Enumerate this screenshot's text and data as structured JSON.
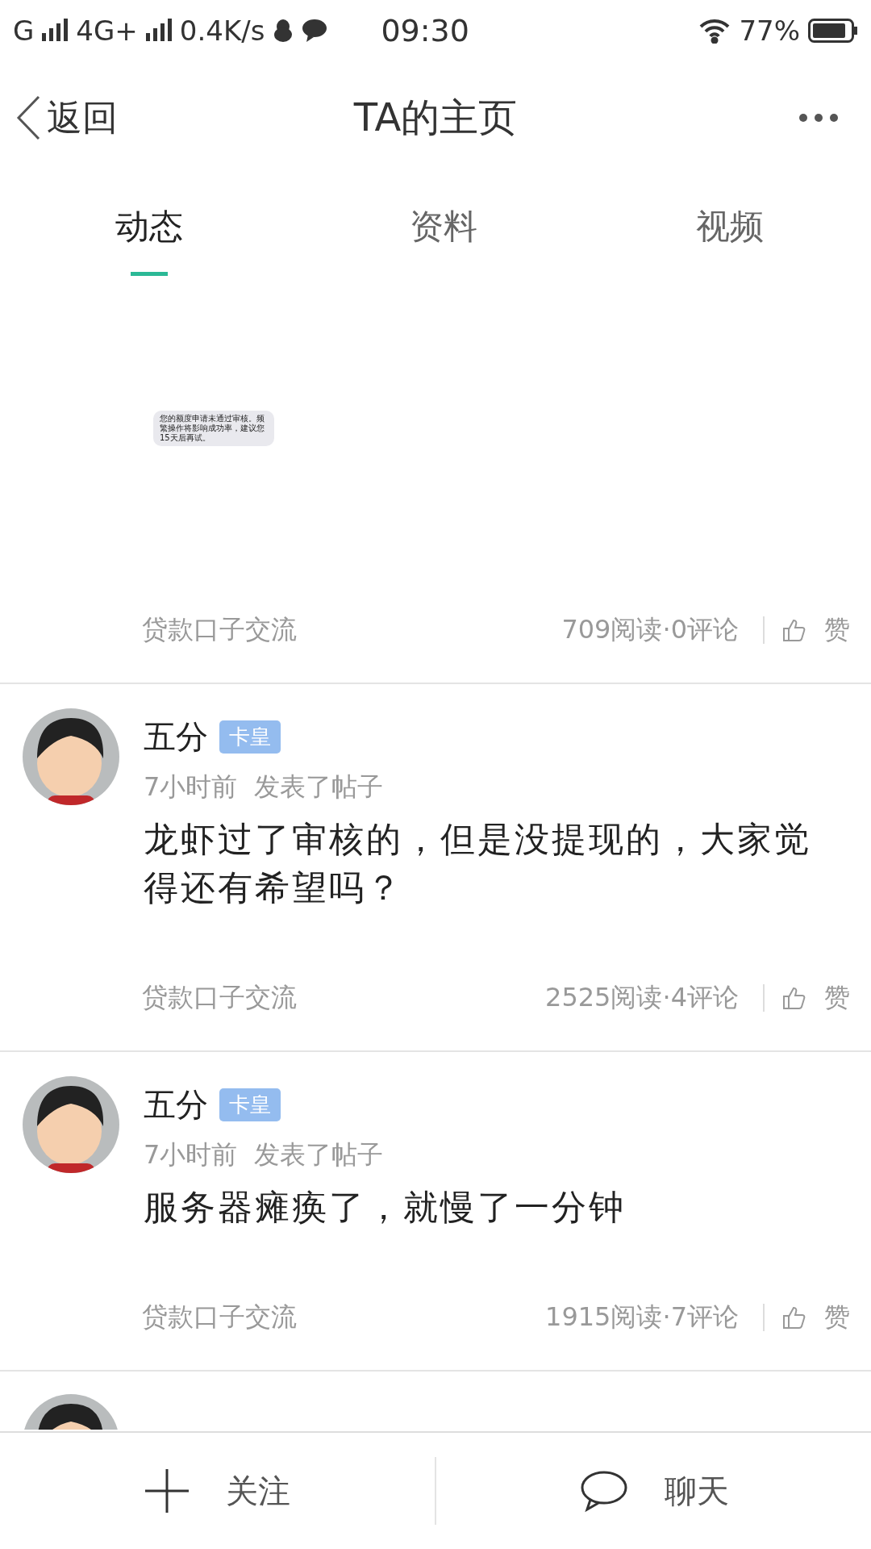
{
  "status_bar": {
    "carrier_1": "G",
    "carrier_2": "4G+",
    "speed": "0.4K/s",
    "time": "09:30",
    "battery": "77%"
  },
  "nav": {
    "back": "返回",
    "title": "TA的主页"
  },
  "tabs": [
    {
      "label": "动态",
      "selected": true
    },
    {
      "label": "资料",
      "selected": false
    },
    {
      "label": "视频",
      "selected": false
    }
  ],
  "posts": [
    {
      "kind": "image",
      "image_text": "您的额度申请未通过审核。频繁操作将影响成功率，建议您15天后再试。",
      "category": "贷款口子交流",
      "stats": "709阅读·0评论",
      "like": "赞"
    },
    {
      "kind": "text",
      "author": "五分",
      "badge": "卡皇",
      "time": "7小时前",
      "action": "发表了帖子",
      "content": "龙虾过了审核的，但是没提现的，大家觉得还有希望吗？",
      "category": "贷款口子交流",
      "stats": "2525阅读·4评论",
      "like": "赞"
    },
    {
      "kind": "text",
      "author": "五分",
      "badge": "卡皇",
      "time": "7小时前",
      "action": "发表了帖子",
      "content": "服务器瘫痪了，就慢了一分钟",
      "category": "贷款口子交流",
      "stats": "1915阅读·7评论",
      "like": "赞"
    },
    {
      "kind": "partial"
    }
  ],
  "bottom_bar": {
    "follow": "关注",
    "chat": "聊天"
  }
}
